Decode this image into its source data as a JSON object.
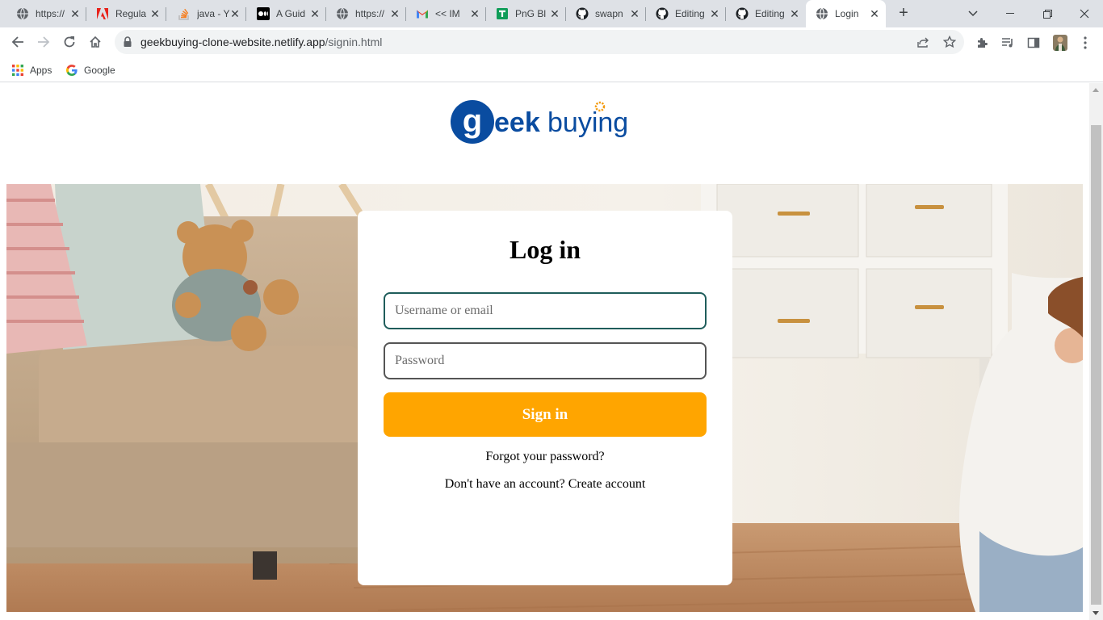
{
  "browser": {
    "tabs": [
      {
        "title": "https://",
        "icon": "globe-icon"
      },
      {
        "title": "Regula",
        "icon": "adobe-icon"
      },
      {
        "title": "java - Y",
        "icon": "stackoverflow-icon"
      },
      {
        "title": "A Guid",
        "icon": "medium-icon"
      },
      {
        "title": "https://",
        "icon": "globe-icon"
      },
      {
        "title": "<< IM",
        "icon": "gmail-icon"
      },
      {
        "title": "PnG Bl",
        "icon": "sheets-icon"
      },
      {
        "title": "swapn",
        "icon": "github-icon"
      },
      {
        "title": "Editing",
        "icon": "github-icon"
      },
      {
        "title": "Editing",
        "icon": "github-icon"
      },
      {
        "title": "Login",
        "icon": "globe-icon",
        "active": true
      }
    ],
    "close_glyph": "✕",
    "new_tab_glyph": "+",
    "url_host": "geekbuying-clone-website.netlify.app",
    "url_path": "/signin.html",
    "bookmarks": [
      {
        "label": "Apps",
        "icon": "apps-grid-icon"
      },
      {
        "label": "Google",
        "icon": "google-icon"
      }
    ]
  },
  "page": {
    "logo_alt": "geekbuying",
    "login": {
      "title": "Log in",
      "username_placeholder": "Username or email",
      "password_placeholder": "Password",
      "signin_label": "Sign in",
      "forgot_label": "Forgot your password?",
      "create_label": "Don't have an account? Create account"
    },
    "colors": {
      "accent": "#ffa500",
      "logo_blue": "#0a4ca0",
      "logo_orange": "#f39c12"
    }
  }
}
